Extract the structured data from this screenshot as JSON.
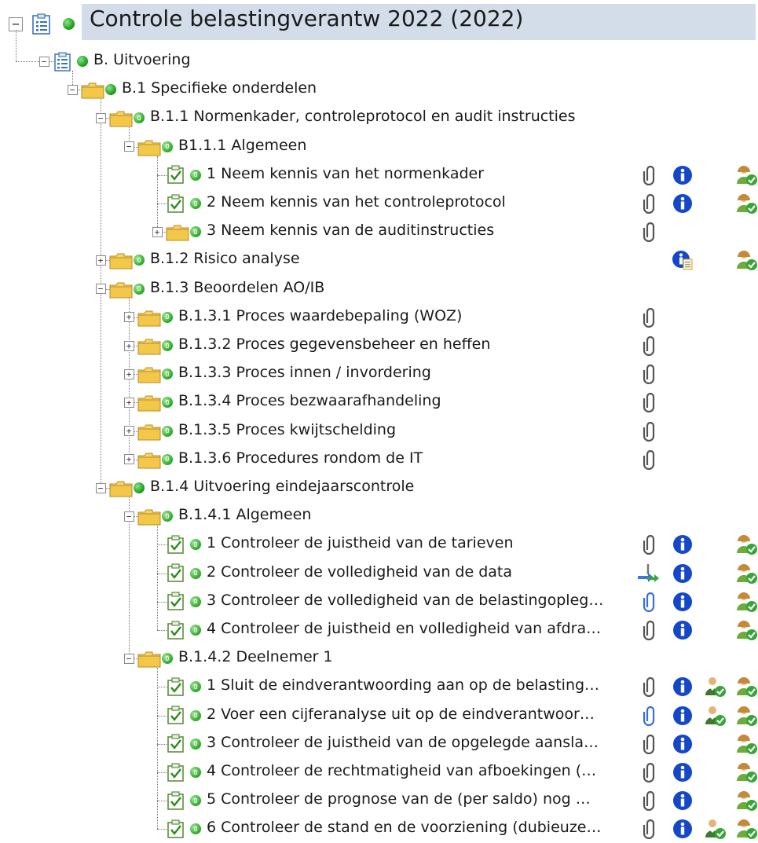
{
  "root": {
    "label": "Controle belastingverantw 2022 (2022)"
  },
  "rows": [
    {
      "label": "B. Uitvoering",
      "level": 1,
      "kind": "doc",
      "dot": "green",
      "exp": "minus",
      "icons": []
    },
    {
      "label": "B.1 Specifieke onderdelen",
      "level": 2,
      "kind": "folder",
      "dot": "green",
      "exp": "minus",
      "icons": []
    },
    {
      "label": "B.1.1 Normenkader, controleprotocol en audit instructies",
      "level": 3,
      "kind": "folder",
      "dot": "gen",
      "exp": "minus",
      "icons": []
    },
    {
      "label": "B1.1.1 Algemeen",
      "level": 4,
      "kind": "folder",
      "dot": "gen",
      "exp": "minus",
      "icons": []
    },
    {
      "label": "1 Neem kennis van het normenkader",
      "level": 5,
      "kind": "check",
      "dot": "gen",
      "exp": "none",
      "icons": [
        "paperclip-icon",
        "info-icon",
        "user-check-icon"
      ]
    },
    {
      "label": "2 Neem kennis van het controleprotocol",
      "level": 5,
      "kind": "check",
      "dot": "gen",
      "exp": "none",
      "icons": [
        "paperclip-icon",
        "info-icon",
        "user-check-icon"
      ]
    },
    {
      "label": "3 Neem kennis van de auditinstructies",
      "level": 5,
      "kind": "folder",
      "dot": "gen",
      "exp": "plus",
      "icons": [
        "paperclip-icon"
      ]
    },
    {
      "label": "B.1.2 Risico analyse",
      "level": 3,
      "kind": "folder",
      "dot": "gen",
      "exp": "plus",
      "icons": [
        "info-note-icon",
        "user-check-icon"
      ]
    },
    {
      "label": "B.1.3 Beoordelen AO/IB",
      "level": 3,
      "kind": "folder",
      "dot": "gen",
      "exp": "minus",
      "icons": []
    },
    {
      "label": "B.1.3.1 Proces waardebepaling (WOZ)",
      "level": 4,
      "kind": "folder",
      "dot": "gen",
      "exp": "plus",
      "icons": [
        "paperclip-icon"
      ]
    },
    {
      "label": "B.1.3.2 Proces gegevensbeheer en heffen",
      "level": 4,
      "kind": "folder",
      "dot": "gen",
      "exp": "plus",
      "icons": [
        "paperclip-icon"
      ]
    },
    {
      "label": "B.1.3.3 Proces innen / invordering",
      "level": 4,
      "kind": "folder",
      "dot": "gen",
      "exp": "plus",
      "icons": [
        "paperclip-icon"
      ]
    },
    {
      "label": "B.1.3.4 Proces bezwaarafhandeling",
      "level": 4,
      "kind": "folder",
      "dot": "gen",
      "exp": "plus",
      "icons": [
        "paperclip-icon"
      ]
    },
    {
      "label": "B.1.3.5 Proces kwijtschelding",
      "level": 4,
      "kind": "folder",
      "dot": "gen",
      "exp": "plus",
      "icons": [
        "paperclip-icon"
      ]
    },
    {
      "label": "B.1.3.6 Procedures rondom de IT",
      "level": 4,
      "kind": "folder",
      "dot": "gen",
      "exp": "plus",
      "icons": [
        "paperclip-icon"
      ]
    },
    {
      "label": "B.1.4 Uitvoering eindejaarscontrole",
      "level": 3,
      "kind": "folder",
      "dot": "green",
      "exp": "minus",
      "icons": []
    },
    {
      "label": "B.1.4.1 Algemeen",
      "level": 4,
      "kind": "folder",
      "dot": "gen",
      "exp": "minus",
      "icons": []
    },
    {
      "label": "1 Controleer de juistheid van de tarieven",
      "level": 5,
      "kind": "check",
      "dot": "gen",
      "exp": "none",
      "icons": [
        "paperclip-icon",
        "info-icon",
        "user-check-icon"
      ]
    },
    {
      "label": "2 Controleer de volledigheid van de data",
      "level": 5,
      "kind": "check",
      "dot": "gen",
      "exp": "none",
      "icons": [
        "transfer-icon",
        "info-icon",
        "user-check-icon"
      ]
    },
    {
      "label": "3 Controleer de volledigheid van de belastingopleg…",
      "level": 5,
      "kind": "check",
      "dot": "gen",
      "exp": "none",
      "icons": [
        "paperclip-blue-icon",
        "info-icon",
        "user-check-icon"
      ]
    },
    {
      "label": "4 Controleer de juistheid en volledigheid van afdra…",
      "level": 5,
      "kind": "check",
      "dot": "gen",
      "exp": "none",
      "icons": [
        "paperclip-icon",
        "info-icon",
        "user-check-icon"
      ]
    },
    {
      "label": "B.1.4.2 Deelnemer 1",
      "level": 4,
      "kind": "folder",
      "dot": "gen",
      "exp": "minus",
      "icons": []
    },
    {
      "label": "1 Sluit de eindverantwoording aan op de belasting…",
      "level": 5,
      "kind": "check",
      "dot": "gen",
      "exp": "none",
      "icons": [
        "paperclip-icon",
        "info-icon",
        "reviewer-icon",
        "user-check-icon"
      ]
    },
    {
      "label": "2 Voer een cijferanalyse uit op de eindverantwoor…",
      "level": 5,
      "kind": "check",
      "dot": "gen",
      "exp": "none",
      "icons": [
        "paperclip-blue-icon",
        "info-icon",
        "reviewer-icon",
        "user-check-icon"
      ]
    },
    {
      "label": "3 Controleer de juistheid van de opgelegde aansla…",
      "level": 5,
      "kind": "check",
      "dot": "gen",
      "exp": "none",
      "icons": [
        "paperclip-icon",
        "info-icon",
        "user-check-icon"
      ]
    },
    {
      "label": "4 Controleer de rechtmatigheid van afboekingen (…",
      "level": 5,
      "kind": "check",
      "dot": "gen",
      "exp": "none",
      "icons": [
        "paperclip-icon",
        "info-icon",
        "user-check-icon"
      ]
    },
    {
      "label": "5 Controleer de prognose van de (per saldo) nog …",
      "level": 5,
      "kind": "check",
      "dot": "gen",
      "exp": "none",
      "icons": [
        "paperclip-icon",
        "info-icon",
        "user-check-icon"
      ]
    },
    {
      "label": "6 Controleer de stand en de voorziening (dubieuze…",
      "level": 5,
      "kind": "check",
      "dot": "gen",
      "exp": "none",
      "icons": [
        "paperclip-icon",
        "info-icon",
        "reviewer-icon",
        "user-check-icon"
      ]
    }
  ],
  "colors": {
    "selection": "#d3dde9",
    "folder": "#f3c84a",
    "info": "#1547c9",
    "status_green": "#1fa51f"
  }
}
